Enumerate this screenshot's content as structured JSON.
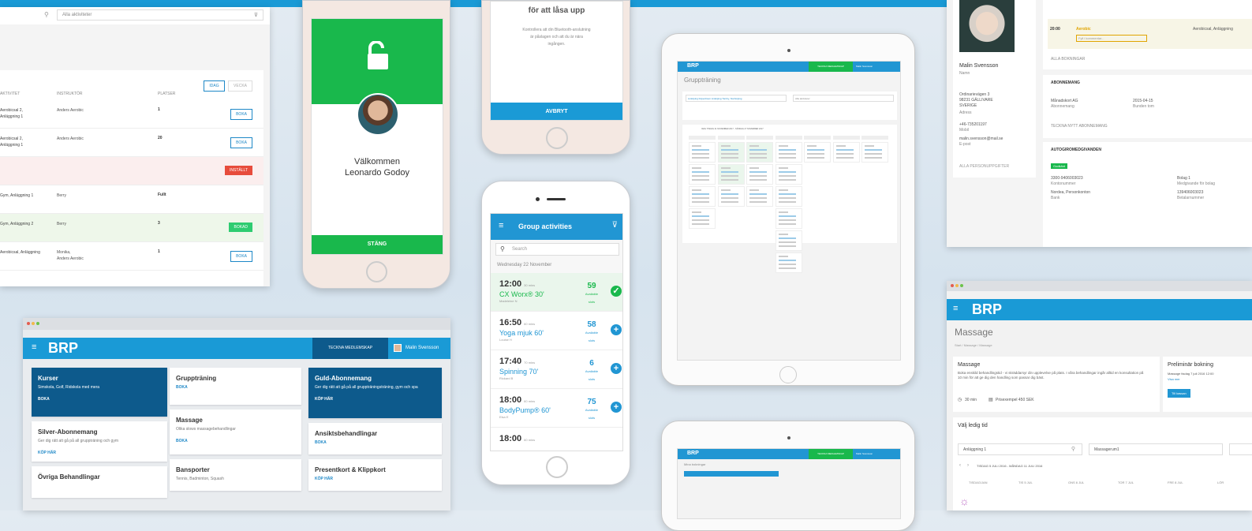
{
  "colors": {
    "brand_blue": "#1a9ad6",
    "success_green": "#19b84c",
    "dark_blue": "#0d5a8c",
    "danger": "#e74c3c"
  },
  "booking_list": {
    "search_placeholder": "Alla aktiviteter",
    "tab_active": "IDAG",
    "tab_inactive": "VECKA",
    "col_headers": [
      "AKTIVITET",
      "INSTRUKTÖR",
      "PLATSER"
    ],
    "rows": [
      {
        "activity": "Aerobicsal 2,\nAnläggning 1",
        "instructor": "Anders Aerobic",
        "places": "1",
        "action": "BOKA"
      },
      {
        "activity": "Aerobicsal 2,\nAnläggning 1",
        "instructor": "Anders Aerobic",
        "places": "20",
        "action": "BOKA"
      },
      {
        "activity": "",
        "instructor": "",
        "places": "",
        "action": "INSTÄLLT"
      },
      {
        "activity": "Gym, Anläggning 1",
        "instructor": "Berry",
        "places": "Fullt",
        "action": ""
      },
      {
        "activity": "Gym, Anläggning 2",
        "instructor": "Berry",
        "places": "3",
        "action": "BOKAD"
      },
      {
        "activity": "Aerobicsal, Anläggning",
        "instructor": "Monika,\nAnders Aerobic",
        "places": "1",
        "action": "BOKA"
      }
    ]
  },
  "phone_welcome": {
    "title": "Välkommen",
    "name": "Leonardo Godoy",
    "close": "STÄNG",
    "lock_icon": "unlock-icon"
  },
  "phone_unlock": {
    "heading": "för att låsa upp",
    "body": "Kontrollera att din Bluetooth-anslutning\när påslagen och att du är nära\ningången.",
    "cancel": "AVBRYT"
  },
  "phone_group": {
    "title": "Group activities",
    "search_placeholder": "Search",
    "date": "Wednesday 22 November",
    "items": [
      {
        "time": "12:00",
        "dur": "30 mins",
        "name": "CX Worx® 30'",
        "instructor": "Madeleine N",
        "slots": "59",
        "slots_label": "Available\nslots",
        "state": "booked"
      },
      {
        "time": "16:50",
        "dur": "60 mins",
        "name": "Yoga mjuk 60'",
        "instructor": "Louise H",
        "slots": "58",
        "slots_label": "Available\nslots",
        "state": "open"
      },
      {
        "time": "17:40",
        "dur": "70 mins",
        "name": "Spinning 70'",
        "instructor": "Rickard B",
        "slots": "6",
        "slots_label": "Available\nslots",
        "state": "open"
      },
      {
        "time": "18:00",
        "dur": "60 mins",
        "name": "BodyPump® 60'",
        "instructor": "Elsa E",
        "slots": "75",
        "slots_label": "Available\nslots",
        "state": "open"
      },
      {
        "time": "18:00",
        "dur": "60 mins",
        "name": "",
        "instructor": "",
        "slots": "",
        "slots_label": "",
        "state": "open"
      }
    ]
  },
  "tablet1": {
    "logo": "BRP",
    "cta": "TECKNA MEDLEMSKAP",
    "user": "Malin Svensson",
    "title": "Gruppträning",
    "filter": "Linköping Köpenhavn Linköping Tornby, Norrköping",
    "filter2": "Alla aktiviteter",
    "week": "IDAG TISDAG 21 NOVEMBER 2017 - SÖNDAG 27 NOVEMBER 2017"
  },
  "tablet2": {
    "logo": "BRP",
    "cta": "TECKNA MEDLEMSKAP",
    "user": "Malin Svensson",
    "title": "Mina bokningar"
  },
  "desktop": {
    "logo": "BRP",
    "cta": "TECKNA MEDLEMSKAP",
    "user": "Malin Svensson",
    "col1": [
      {
        "title": "Kurser",
        "desc": "Simskola, Golf, Ridskola med mera",
        "link": "BOKA",
        "dark": true
      },
      {
        "title": "Silver-Abonnemang",
        "desc": "Ger dig rätt att gå på all gruppträning och gym",
        "link": "KÖP HÄR",
        "dark": false
      },
      {
        "title": "Övriga Behandlingar",
        "desc": "",
        "link": "",
        "dark": false
      }
    ],
    "col2": [
      {
        "title": "Gruppträning",
        "desc": "",
        "link": "BOKA",
        "dark": false
      },
      {
        "title": "Massage",
        "desc": "Olika slows massagebehandlingar",
        "link": "BOKA",
        "dark": false
      },
      {
        "title": "Bansporter",
        "desc": "Tennis, Badminton, Squash",
        "link": "",
        "dark": false
      }
    ],
    "col3": [
      {
        "title": "Guld-Abonnemang",
        "desc": "Ger dig rätt att gå på all gruppträningsträning, gym och spa",
        "link": "KÖP HÄR",
        "dark": true
      },
      {
        "title": "Ansiktsbehandlingar",
        "desc": "",
        "link": "BOKA",
        "dark": false
      },
      {
        "title": "Presentkort & Klippkort",
        "desc": "",
        "link": "KÖP HÄR",
        "dark": false
      }
    ]
  },
  "profile": {
    "name": "Malin Svensson",
    "name_sub": "Namn",
    "address": "Ordinarievägen 3\n98231 GÄLLIVARE\nSVERIGE",
    "address_sub": "Adress",
    "phone": "+46-735201197",
    "phone_sub": "Mobil",
    "email": "malin.svensson@mail.se",
    "email_sub": "E-post",
    "all_persons": "ALLA PERSONUPPGIFTER",
    "slot_time": "20:00",
    "slot_name": "Aerobic",
    "slot_place": "Aerobicsal, Anläggning",
    "select_placeholder": "Fyll i kommentar...",
    "all_bookings": "ALLA BOKNINGAR",
    "sub_head": "ABONNEMANG",
    "sub_name": "Månadskort AG",
    "sub_name_sub": "Abonnemang",
    "sub_date": "2015-04-15",
    "sub_date_sub": "Bunden tom",
    "sign_new": "TECKNA NYTT ABONNEMANG",
    "autogiro_head": "AUTOGIROMEDGIVANDEN",
    "autogiro_badge": "Godkänt",
    "ag_number": "3300-9406003023",
    "ag_number_sub": "Kontonummer",
    "ag_bank": "Nordea, Personkonton",
    "ag_bank_sub": "Bank",
    "ag_company": "Bolag 1",
    "ag_company_sub": "Medgivande för bolag",
    "ag_ref": "139406003023",
    "ag_ref_sub": "Betalarnummer"
  },
  "massage": {
    "logo": "BRP",
    "title": "Massage",
    "breadcrumb": "Start / Massage / Massage",
    "desc_title": "Massage",
    "desc": "Boka enskild behandlingstid - vi skräddarsyr din upplevelse på plats. I våra behandlingar ingår alltid en konsultation på 10 min för att ge dig den handling som passar dig bäst.",
    "duration": "30 min",
    "price": "Prisexempel 450 SEK",
    "prelim_title": "Preliminär bokning",
    "prelim_text": "Massage tisdag 7 juli 2016 12:00",
    "prelim_more": "Visa mer",
    "checkout": "Till kassan",
    "choose": "Välj ledig tid",
    "place": "Anläggning 1",
    "type": "Massagerum1",
    "range": "TISDAG 5 JULI 2016 - MÅNDAG 11 JULI 2016",
    "days": [
      "TISDAG/JAN",
      "TIS 5 JUL",
      "ONS 6 JUL",
      "TOR 7 JUL",
      "FRE 8 JUL",
      "LÖR"
    ]
  }
}
